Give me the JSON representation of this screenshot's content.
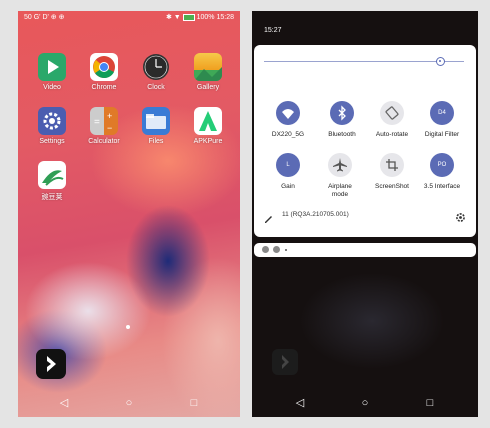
{
  "home": {
    "status_left": "50 G' D' ⊕ ⊕",
    "status_right": "100% 15:28",
    "apps": [
      {
        "label": "Video",
        "icon": "play-icon",
        "color": "#2aa86a"
      },
      {
        "label": "Chrome",
        "icon": "chrome-icon",
        "color": "#ffffff"
      },
      {
        "label": "Clock",
        "icon": "clock-icon",
        "color": "#333333"
      },
      {
        "label": "Gallery",
        "icon": "gallery-icon",
        "color": "#f0a020"
      },
      {
        "label": "Settings",
        "icon": "gear-icon",
        "color": "#4b5db0"
      },
      {
        "label": "Calculator",
        "icon": "calculator-icon",
        "color": "#e07a28"
      },
      {
        "label": "Files",
        "icon": "folder-icon",
        "color": "#3a7bd5"
      },
      {
        "label": "APKPure",
        "icon": "apkpure-icon",
        "color": "#ffffff"
      },
      {
        "label": "豌豆荚",
        "icon": "wandoujia-icon",
        "color": "#ffffff"
      }
    ]
  },
  "shade": {
    "time": "15:27",
    "brightness": 0.9,
    "tiles": [
      {
        "label": "DX220_5G",
        "icon": "wifi-icon",
        "on": true,
        "glyph": ""
      },
      {
        "label": "Bluetooth",
        "icon": "bluetooth-icon",
        "on": true,
        "glyph": ""
      },
      {
        "label": "Auto-rotate",
        "icon": "rotate-icon",
        "on": false,
        "glyph": ""
      },
      {
        "label": "Digital Filter",
        "icon": "filter-icon",
        "on": true,
        "glyph": "D4"
      },
      {
        "label": "Gain",
        "icon": "gain-icon",
        "on": true,
        "glyph": "L"
      },
      {
        "label": "Airplane mode",
        "icon": "airplane-icon",
        "on": false,
        "glyph": ""
      },
      {
        "label": "ScreenShot",
        "icon": "screenshot-icon",
        "on": false,
        "glyph": ""
      },
      {
        "label": "3.5 Interface",
        "icon": "interface-icon",
        "on": true,
        "glyph": "PO"
      }
    ],
    "build": "11 (RQ3A.210705.001)"
  },
  "nav": {
    "back": "◁",
    "home": "○",
    "recents": "□"
  }
}
